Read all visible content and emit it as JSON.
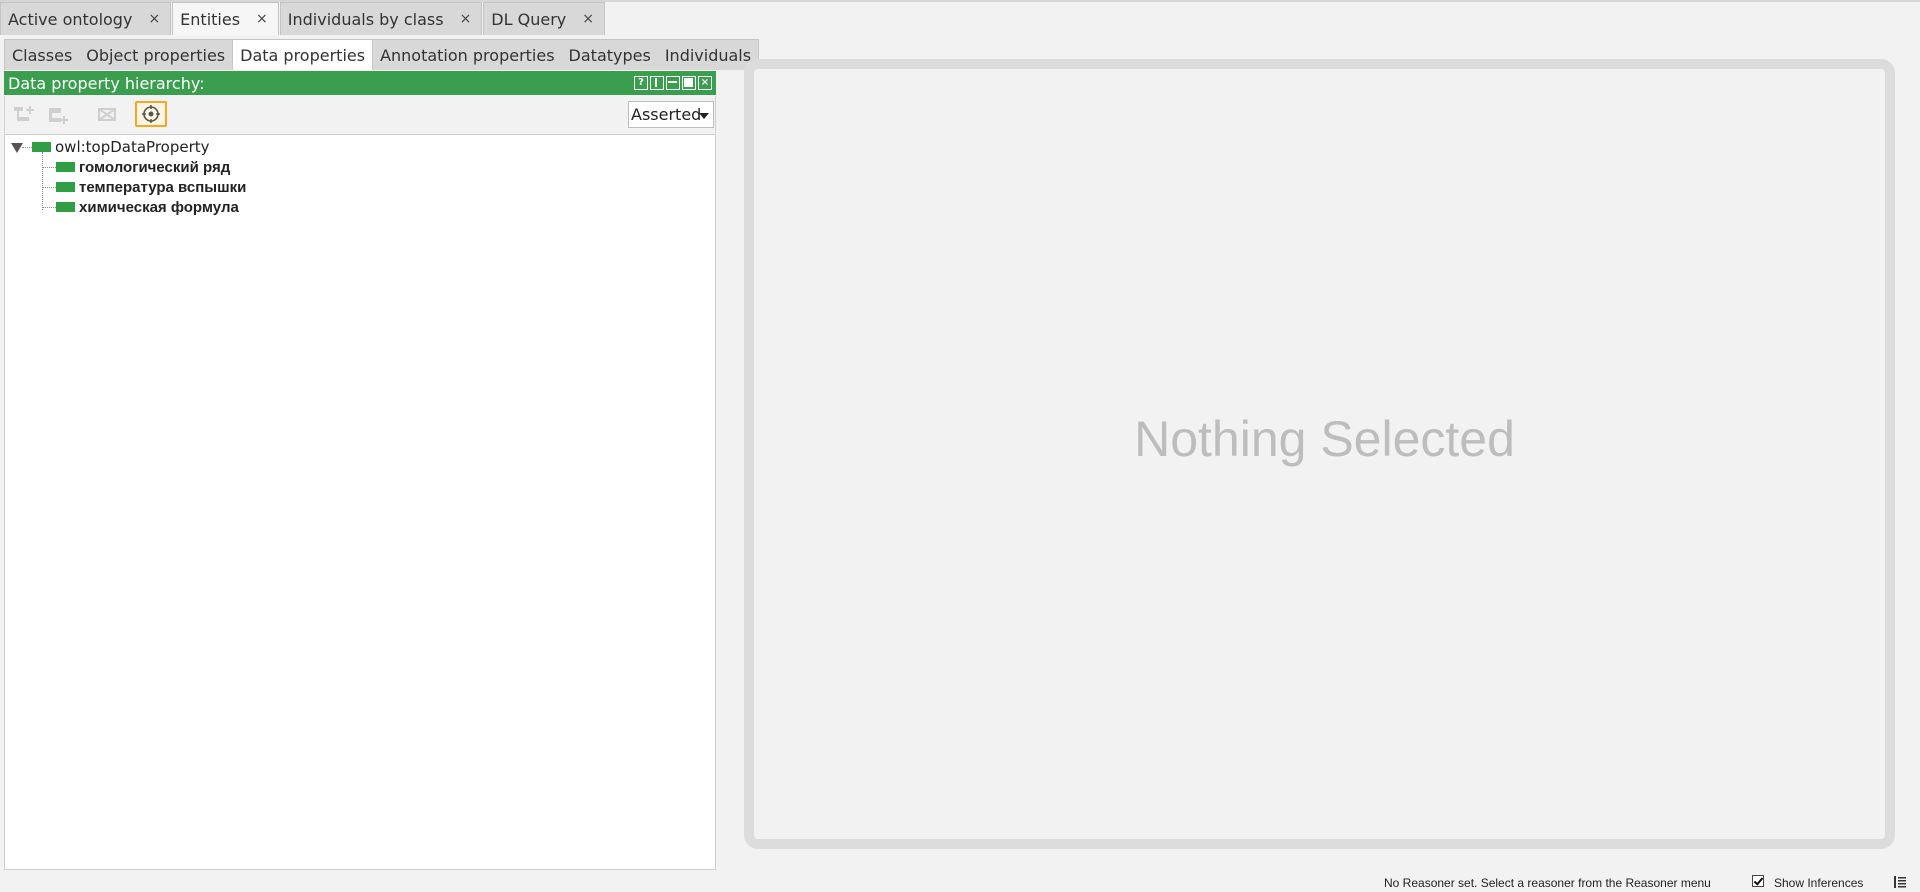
{
  "workspace_tabs": [
    {
      "label": "Active ontology",
      "close": "×",
      "active": false
    },
    {
      "label": "Entities",
      "close": "×",
      "active": true
    },
    {
      "label": "Individuals by class",
      "close": "×",
      "active": false
    },
    {
      "label": "DL Query",
      "close": "×",
      "active": false
    }
  ],
  "entity_tabs": [
    {
      "label": "Classes",
      "active": false
    },
    {
      "label": "Object properties",
      "active": false
    },
    {
      "label": "Data properties",
      "active": true
    },
    {
      "label": "Annotation properties",
      "active": false
    },
    {
      "label": "Datatypes",
      "active": false
    },
    {
      "label": "Individuals",
      "active": false
    }
  ],
  "hierarchy_view": {
    "title": "Data property hierarchy:",
    "controls": [
      "help-icon",
      "split-icon",
      "minimize-icon",
      "maximize-icon",
      "close-icon"
    ],
    "toolbar": [
      "add-sub-property-icon",
      "add-sibling-property-icon",
      "delete-property-icon",
      "sync-icon"
    ],
    "mode": "Asserted",
    "root": "owl:topDataProperty",
    "children": [
      "гомологический ряд",
      "температура вспышки",
      "химическая формула"
    ],
    "accent_color": "#3a9e4e"
  },
  "detail_panel": {
    "placeholder": "Nothing Selected"
  },
  "status_bar": {
    "message": "No Reasoner set. Select a reasoner from the Reasoner menu",
    "show_inferences_label": "Show Inferences",
    "show_inferences_checked": true
  }
}
